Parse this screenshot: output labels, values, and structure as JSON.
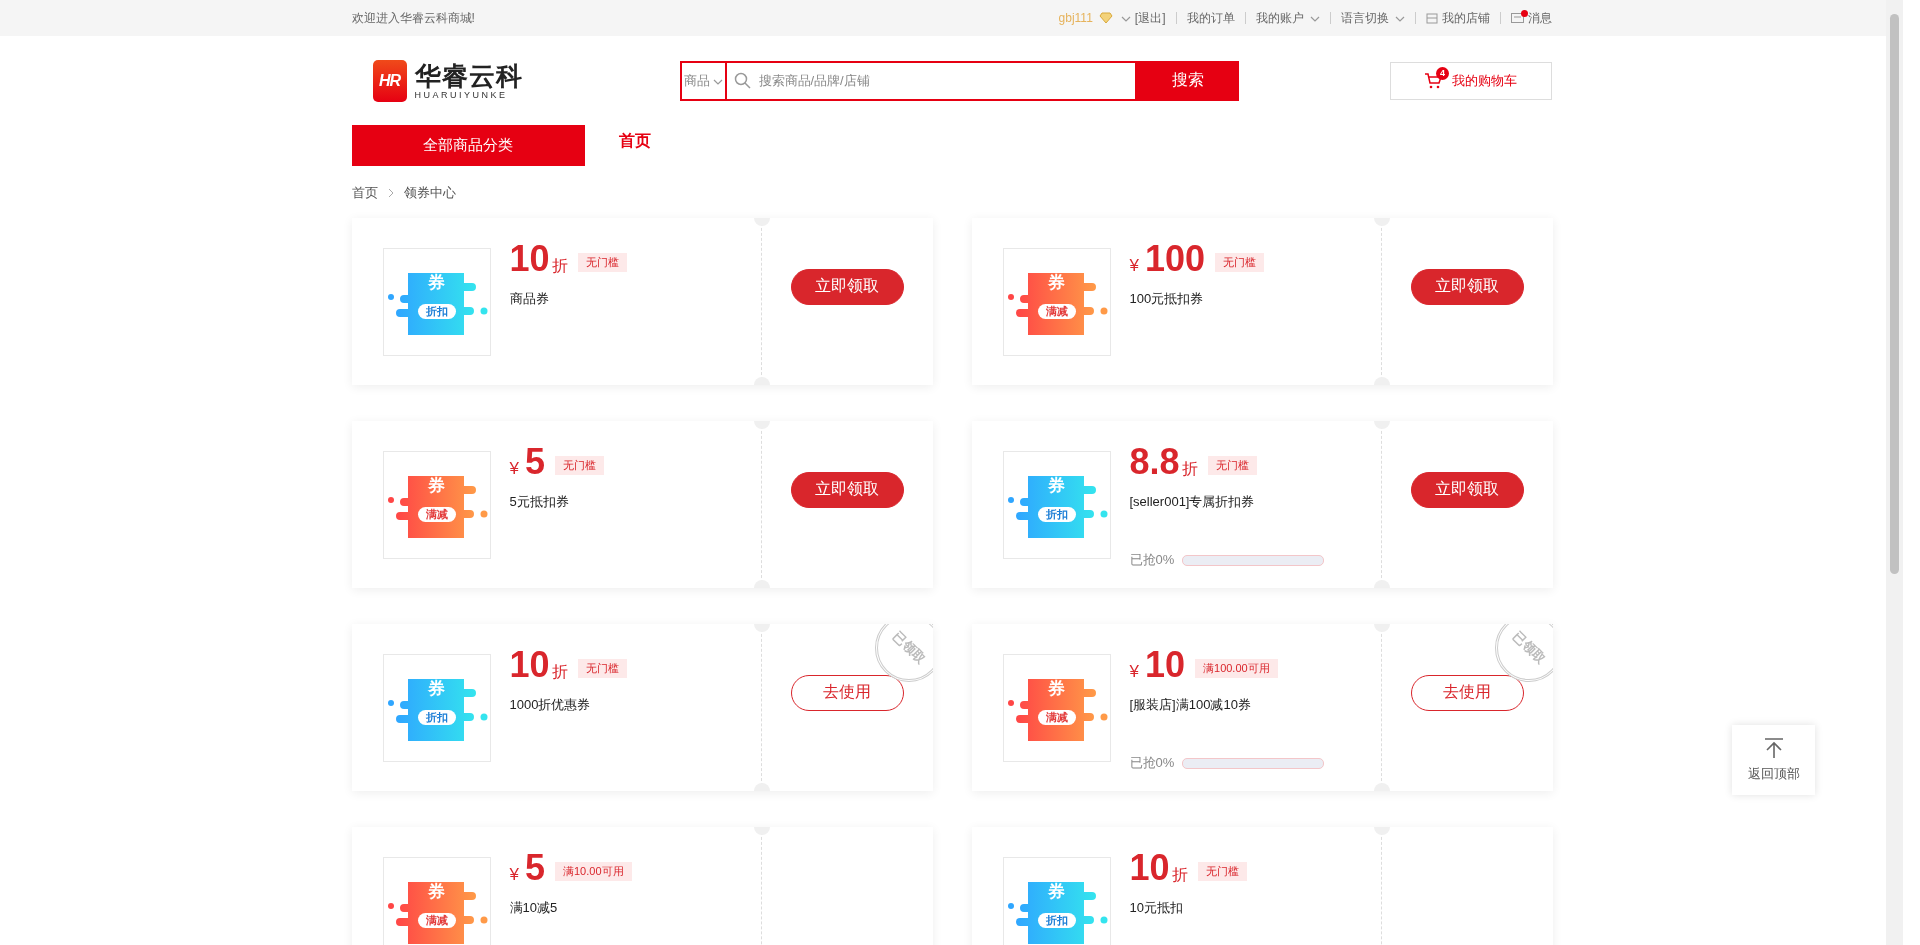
{
  "top_bar": {
    "welcome": "欢迎进入华睿云科商城!",
    "username": "gbj111",
    "logout": "[退出]",
    "links": [
      {
        "label": "我的订单",
        "kind": "plain"
      },
      {
        "label": "我的账户",
        "kind": "dropdown"
      },
      {
        "label": "语言切换",
        "kind": "dropdown"
      },
      {
        "label": "我的店铺",
        "kind": "store"
      },
      {
        "label": "消息",
        "kind": "message"
      }
    ]
  },
  "header": {
    "logo_mark": "HR",
    "brand": "华睿云科",
    "brand_sub": "HUARUIYUNKE",
    "search": {
      "scope": "商品",
      "placeholder": "搜索商品/品牌/店铺",
      "button": "搜索"
    },
    "cart": {
      "label": "我的购物车",
      "count": "4"
    }
  },
  "nav": {
    "category_button": "全部商品分类",
    "links": [
      {
        "label": "首页",
        "selected": true
      }
    ]
  },
  "breadcrumb": [
    "首页",
    "领券中心"
  ],
  "coupons": [
    {
      "kind": "discount",
      "symbol": "券",
      "type_label": "折扣",
      "value": "10",
      "unit": "折",
      "condition": "无门槛",
      "name": "商品券",
      "button": {
        "label": "立即领取",
        "kind": "claim"
      }
    },
    {
      "kind": "cash",
      "symbol": "券",
      "type_label": "满减",
      "value": "100",
      "unit": "¥",
      "condition": "无门槛",
      "name": "100元抵扣券",
      "button": {
        "label": "立即领取",
        "kind": "claim"
      }
    },
    {
      "kind": "cash",
      "symbol": "券",
      "type_label": "满减",
      "value": "5",
      "unit": "¥",
      "condition": "无门槛",
      "name": "5元抵扣券",
      "button": {
        "label": "立即领取",
        "kind": "claim"
      }
    },
    {
      "kind": "discount",
      "symbol": "券",
      "type_label": "折扣",
      "value": "8.8",
      "unit": "折",
      "condition": "无门槛",
      "name": "[seller001]专属折扣券",
      "progress": {
        "label": "已抢0%",
        "level": 0
      },
      "button": {
        "label": "立即领取",
        "kind": "claim"
      }
    },
    {
      "kind": "discount",
      "symbol": "券",
      "type_label": "折扣",
      "value": "10",
      "unit": "折",
      "condition": "无门槛",
      "name": "1000折优惠券",
      "stamp": "已领取",
      "button": {
        "label": "去使用",
        "kind": "use"
      }
    },
    {
      "kind": "cash",
      "symbol": "券",
      "type_label": "满减",
      "value": "10",
      "unit": "¥",
      "condition": "满100.00可用",
      "name": "[服装店]满100减10券",
      "progress": {
        "label": "已抢0%",
        "level": 0
      },
      "stamp": "已领取",
      "button": {
        "label": "去使用",
        "kind": "use"
      }
    },
    {
      "kind": "cash",
      "symbol": "券",
      "type_label": "满减",
      "value": "5",
      "unit": "¥",
      "condition": "满10.00可用",
      "name": "满10减5"
    },
    {
      "kind": "discount",
      "symbol": "券",
      "type_label": "折扣",
      "value": "10",
      "unit": "折",
      "condition": "无门槛",
      "name": "10元抵扣"
    }
  ],
  "back_to_top": "返回顶部"
}
